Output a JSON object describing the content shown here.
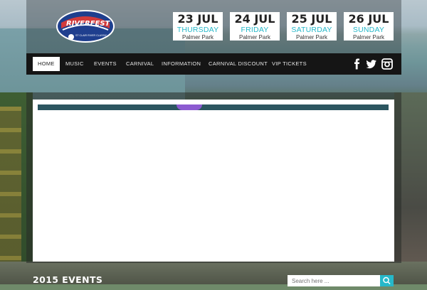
{
  "brand": {
    "logo_text": "RIVERFEST",
    "logo_subtext": "ST CLAIR RIVER CLASSIC",
    "accent": "#26b8c9"
  },
  "dates": [
    {
      "date": "23 JUL",
      "day": "THURSDAY",
      "venue": "Palmer Park"
    },
    {
      "date": "24 JUL",
      "day": "FRIDAY",
      "venue": "Palmer Park"
    },
    {
      "date": "25 JUL",
      "day": "SATURDAY",
      "venue": "Palmer Park"
    },
    {
      "date": "26 JUL",
      "day": "SUNDAY",
      "venue": "Palmer Park"
    }
  ],
  "nav": {
    "items": [
      "HOME",
      "MUSIC",
      "EVENTS",
      "CARNIVAL",
      "INFORMATION",
      "CARNIVAL DISCOUNT",
      "VIP TICKETS"
    ],
    "social_icons": [
      "facebook-icon",
      "twitter-icon",
      "instagram-icon"
    ]
  },
  "events": {
    "title": "2015 EVENTS"
  },
  "search": {
    "placeholder": "Search here ...",
    "icon": "search-icon"
  }
}
